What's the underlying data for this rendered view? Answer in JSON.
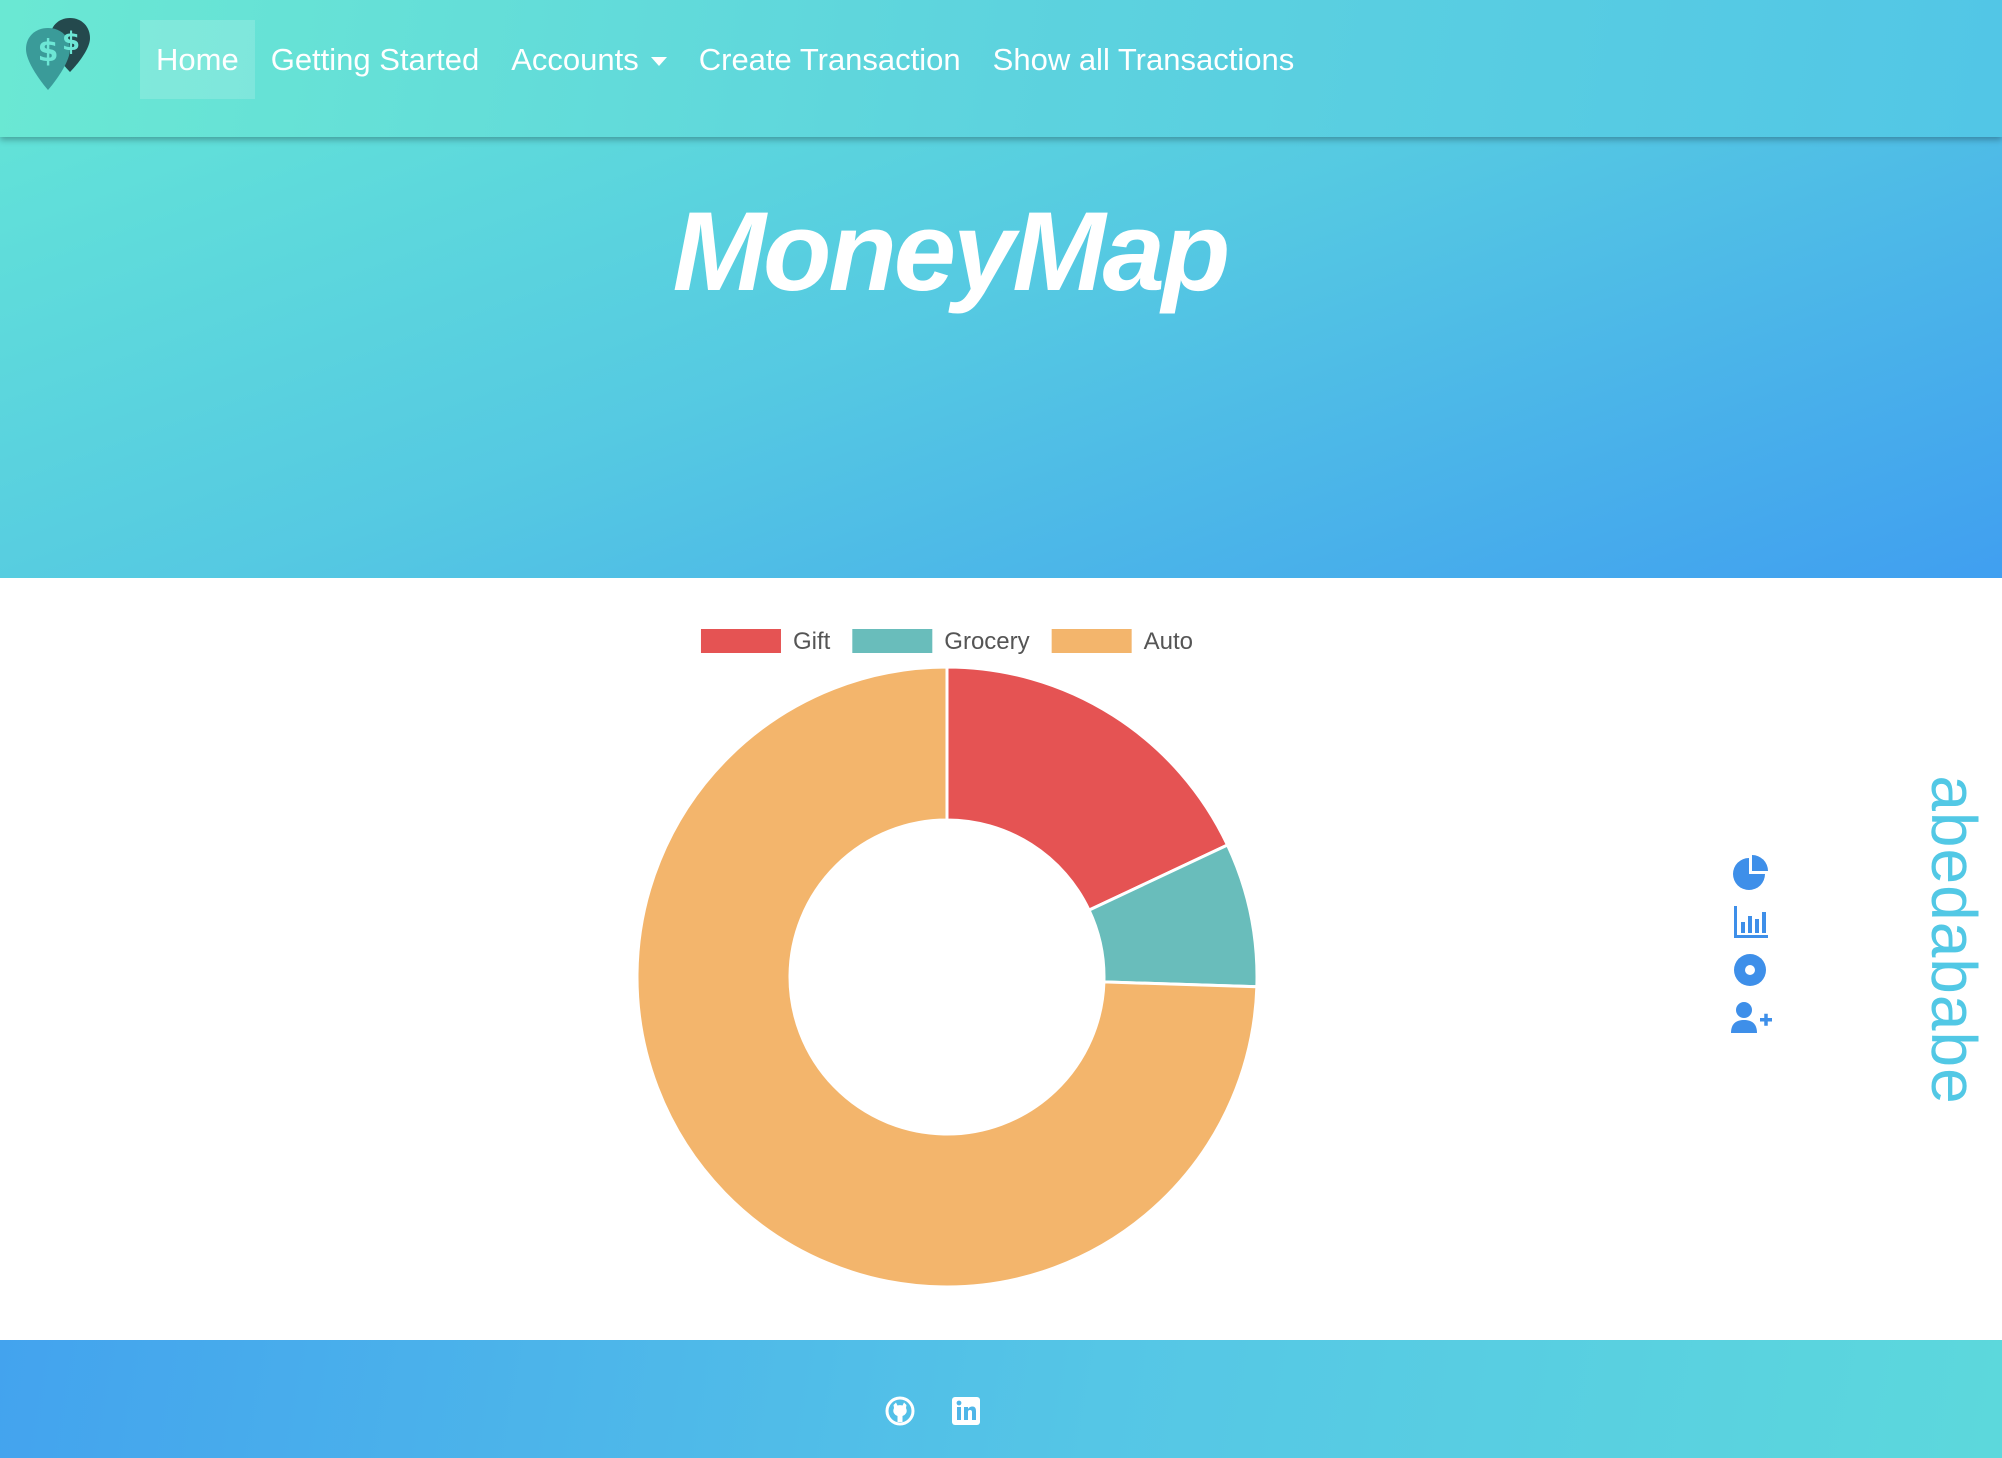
{
  "navbar": {
    "brand_icon": "money-map-pin-logo-icon",
    "links": [
      {
        "label": "Home",
        "active": true
      },
      {
        "label": "Getting Started"
      },
      {
        "label": "Accounts",
        "dropdown": true
      },
      {
        "label": "Create Transaction"
      },
      {
        "label": "Show all Transactions"
      }
    ]
  },
  "hero": {
    "title": "MoneyMap"
  },
  "chart_data": {
    "type": "pie",
    "variant": "doughnut",
    "categories": [
      "Gift",
      "Grocery",
      "Auto"
    ],
    "values": [
      18,
      7.5,
      74.5
    ],
    "colors": [
      "#e55353",
      "#69bdbb",
      "#f3b56c"
    ],
    "legend": "top-center"
  },
  "sidebar": {
    "icons": [
      "pie-chart-icon",
      "bar-chart-icon",
      "dot-circle-icon",
      "user-plus-icon"
    ],
    "username": "abedababe"
  },
  "footer": {
    "icons": [
      "github-icon",
      "linkedin-icon"
    ]
  },
  "colors": {
    "accent": "#3e8fe9",
    "nav_gradient_start": "#6ae8d3",
    "hero_gradient_end": "#409ff0"
  }
}
